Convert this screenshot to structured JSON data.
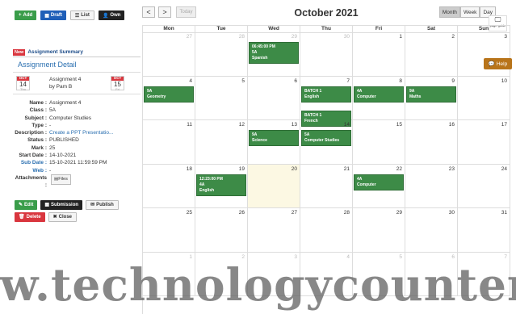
{
  "toolbar": {
    "add": "Add",
    "draft": "Draft",
    "list": "List",
    "own": "Own"
  },
  "panel": {
    "new_badge": "New",
    "summary_title": "Assignment Summary",
    "detail_title": "Assignment Detail",
    "start_cal": {
      "month": "OCT",
      "day": "14",
      "weekday": "Thu"
    },
    "end_cal": {
      "month": "OCT",
      "day": "15",
      "weekday": "Fri"
    },
    "assignment_name": "Assignment 4",
    "assignment_by": "by Pam B",
    "fields": [
      {
        "k": "Name :",
        "v": "Assignment 4"
      },
      {
        "k": "Class :",
        "v": "5A"
      },
      {
        "k": "Subject :",
        "v": "Computer Studies"
      },
      {
        "k": "Type :",
        "v": "-"
      },
      {
        "k": "Description :",
        "v": "Create a PPT Presentatio..."
      },
      {
        "k": "Status :",
        "v": "PUBLISHED"
      },
      {
        "k": "Mark :",
        "v": "25"
      },
      {
        "k": "Start Date :",
        "v": "14-10-2021"
      },
      {
        "k": "Sub Date :",
        "v": "15-10-2021 11:59:59 PM"
      },
      {
        "k": "Web :",
        "v": "-"
      },
      {
        "k": "Attachments :",
        "v": ""
      }
    ],
    "files_btn": "Files",
    "edit": "Edit",
    "submission": "Submission",
    "publish": "Publish",
    "delete": "Delete",
    "close": "Close"
  },
  "calendar": {
    "title": "October 2021",
    "today_btn": "Today",
    "prev": "<",
    "next": ">",
    "views": [
      "Month",
      "Week",
      "Day"
    ],
    "active_view": "Month",
    "weekdays": [
      "Mon",
      "Tue",
      "Wed",
      "Thu",
      "Fri",
      "Sat",
      "Sun"
    ],
    "weeks": [
      [
        "27",
        "28",
        "29",
        "30",
        "1",
        "2",
        "3"
      ],
      [
        "4",
        "5",
        "6",
        "7",
        "8",
        "9",
        "10"
      ],
      [
        "11",
        "12",
        "13",
        "14",
        "15",
        "16",
        "17"
      ],
      [
        "18",
        "19",
        "20",
        "21",
        "22",
        "23",
        "24"
      ],
      [
        "25",
        "26",
        "27",
        "28",
        "29",
        "30",
        "31"
      ],
      [
        "1",
        "2",
        "3",
        "4",
        "5",
        "6",
        "7"
      ]
    ],
    "events": [
      {
        "text": [
          "06:45:00 PM",
          "5A",
          "Spanish"
        ]
      },
      {
        "text": [
          "9A",
          "Geometry"
        ]
      },
      {
        "text": [
          "BATCH 1",
          "English"
        ]
      },
      {
        "text": [
          "BATCH 1",
          "French"
        ]
      },
      {
        "text": [
          "4A",
          "Computer"
        ]
      },
      {
        "text": [
          "9A",
          "Maths"
        ]
      },
      {
        "text": [
          "9A",
          "Science"
        ]
      },
      {
        "text": [
          "5A",
          "Computer Studies"
        ]
      },
      {
        "text": [
          "12:23:00 PM",
          "4A",
          "English"
        ]
      },
      {
        "text": [
          "4A",
          "Computer"
        ]
      }
    ]
  },
  "page_guide": "page guide",
  "help": "Help",
  "watermark": "w.technologycounter"
}
